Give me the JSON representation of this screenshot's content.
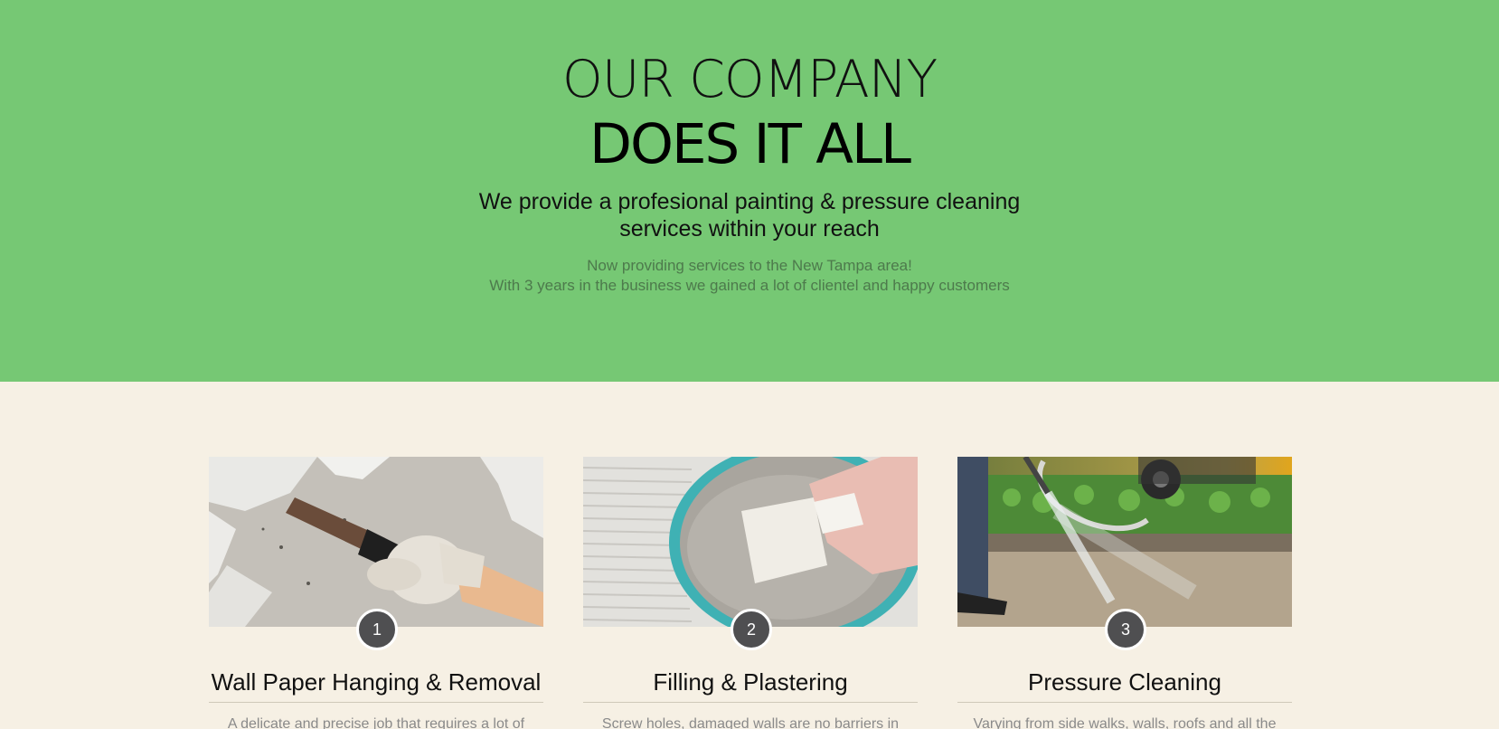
{
  "hero": {
    "heading_line1": "OUR COMPANY",
    "heading_line2": "DOES IT ALL",
    "tagline_line1": "We provide a profesional painting & pressure cleaning",
    "tagline_line2": "services within your reach",
    "sub_line1": "Now providing services to the New Tampa area!",
    "sub_line2": "With 3 years in the business we gained a lot of clientel and happy customers",
    "background_color": "#76c874"
  },
  "services": [
    {
      "number": "1",
      "title": "Wall Paper Hanging & Removal",
      "description": "A delicate and precise job that requires a lot of",
      "image_icon": "wallpaper-scraper-photo"
    },
    {
      "number": "2",
      "title": "Filling & Plastering",
      "description": "Screw holes, damaged walls are no barriers in",
      "image_icon": "plaster-bowl-photo"
    },
    {
      "number": "3",
      "title": "Pressure Cleaning",
      "description": "Varying from side walks, walls, roofs and all the",
      "image_icon": "pressure-washer-photo"
    }
  ],
  "colors": {
    "page_background": "#f6f0e4",
    "badge": "#4f4f51"
  }
}
